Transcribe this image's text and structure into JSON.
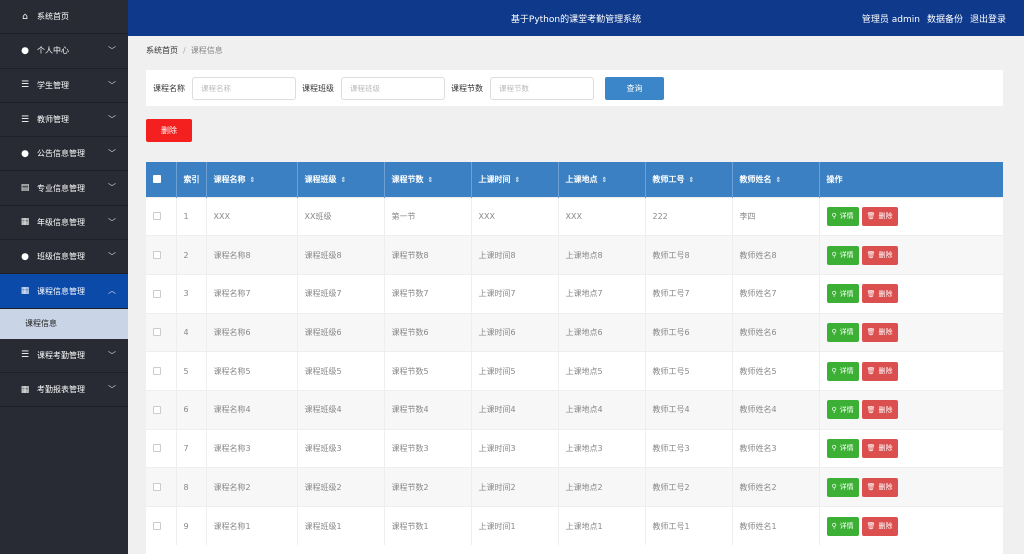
{
  "sidebar": {
    "items": [
      {
        "label": "系统首页",
        "icon": "home-icon",
        "chevron": false
      },
      {
        "label": "个人中心",
        "icon": "user-icon",
        "chevron": true
      },
      {
        "label": "学生管理",
        "icon": "sliders-icon",
        "chevron": true
      },
      {
        "label": "教师管理",
        "icon": "list-icon",
        "chevron": true
      },
      {
        "label": "公告信息管理",
        "icon": "user-icon",
        "chevron": true
      },
      {
        "label": "专业信息管理",
        "icon": "clipboard-icon",
        "chevron": true
      },
      {
        "label": "年级信息管理",
        "icon": "grid-icon",
        "chevron": true
      },
      {
        "label": "班级信息管理",
        "icon": "user-icon",
        "chevron": true
      },
      {
        "label": "课程信息管理",
        "icon": "grid-icon",
        "chevron": true,
        "active": true
      },
      {
        "label": "课程考勤管理",
        "icon": "list-icon",
        "chevron": true
      },
      {
        "label": "考勤报表管理",
        "icon": "table-icon",
        "chevron": true
      }
    ],
    "sub_item": "课程信息"
  },
  "header": {
    "title": "基于Python的课堂考勤管理系统",
    "admin": "管理员 admin",
    "backup": "数据备份",
    "logout": "退出登录"
  },
  "breadcrumb": {
    "home": "系统首页",
    "separator": "/",
    "current": "课程信息"
  },
  "search": {
    "fields": [
      {
        "label": "课程名称",
        "placeholder": "课程名称"
      },
      {
        "label": "课程班级",
        "placeholder": "课程班级"
      },
      {
        "label": "课程节数",
        "placeholder": "课程节数"
      }
    ],
    "query_label": "查询"
  },
  "delete_label": "删除",
  "table": {
    "headers": [
      "索引",
      "课程名称",
      "课程班级",
      "课程节数",
      "上课时间",
      "上课地点",
      "教师工号",
      "教师姓名",
      "操作"
    ],
    "sort_glyph": "⇕",
    "rows": [
      [
        "1",
        "XXX",
        "XX班级",
        "第一节",
        "XXX",
        "XXX",
        "222",
        "李四"
      ],
      [
        "2",
        "课程名称8",
        "课程班级8",
        "课程节数8",
        "上课时间8",
        "上课地点8",
        "教师工号8",
        "教师姓名8"
      ],
      [
        "3",
        "课程名称7",
        "课程班级7",
        "课程节数7",
        "上课时间7",
        "上课地点7",
        "教师工号7",
        "教师姓名7"
      ],
      [
        "4",
        "课程名称6",
        "课程班级6",
        "课程节数6",
        "上课时间6",
        "上课地点6",
        "教师工号6",
        "教师姓名6"
      ],
      [
        "5",
        "课程名称5",
        "课程班级5",
        "课程节数5",
        "上课时间5",
        "上课地点5",
        "教师工号5",
        "教师姓名5"
      ],
      [
        "6",
        "课程名称4",
        "课程班级4",
        "课程节数4",
        "上课时间4",
        "上课地点4",
        "教师工号4",
        "教师姓名4"
      ],
      [
        "7",
        "课程名称3",
        "课程班级3",
        "课程节数3",
        "上课时间3",
        "上课地点3",
        "教师工号3",
        "教师姓名3"
      ],
      [
        "8",
        "课程名称2",
        "课程班级2",
        "课程节数2",
        "上课时间2",
        "上课地点2",
        "教师工号2",
        "教师姓名2"
      ],
      [
        "9",
        "课程名称1",
        "课程班级1",
        "课程节数1",
        "上课时间1",
        "上课地点1",
        "教师工号1",
        "教师姓名1"
      ]
    ],
    "detail_label": "详情",
    "row_delete_label": "删除"
  },
  "colors": {
    "topbar": "#0f3a8c",
    "sidebar": "#282b33",
    "active": "#0b4aa8",
    "table_header": "#3a80c3",
    "detail": "#3cb035",
    "delete": "#dc4f4f"
  }
}
